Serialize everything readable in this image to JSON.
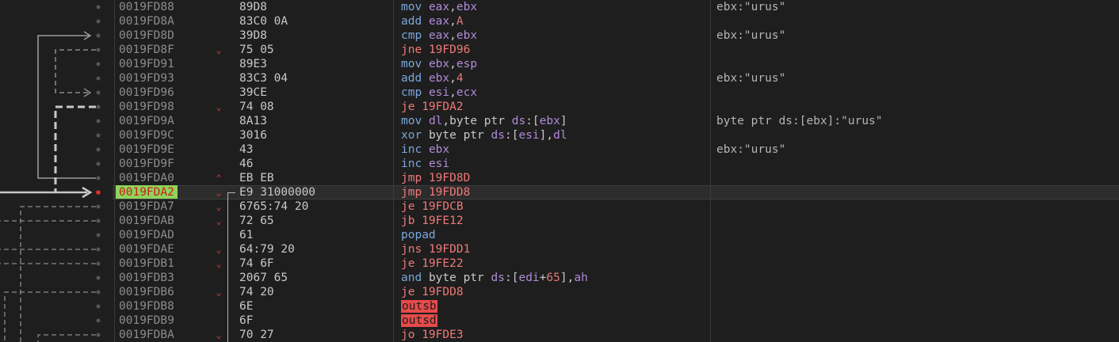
{
  "rows": [
    {
      "addr": "0019FD88",
      "mark": "",
      "bytes": "89D8",
      "mn": "mov",
      "ops": "eax,ebx",
      "kind": "m",
      "comment": "ebx:\"urus\""
    },
    {
      "addr": "0019FD8A",
      "mark": "",
      "bytes": "83C0 0A",
      "mn": "add",
      "ops": "eax,A",
      "kind": "m",
      "comment": ""
    },
    {
      "addr": "0019FD8D",
      "mark": "",
      "bytes": "39D8",
      "mn": "cmp",
      "ops": "eax,ebx",
      "kind": "m",
      "comment": "ebx:\"urus\""
    },
    {
      "addr": "0019FD8F",
      "mark": "⌄",
      "bytes": "75 05",
      "mn": "jne",
      "ops": "19FD96",
      "kind": "j",
      "comment": ""
    },
    {
      "addr": "0019FD91",
      "mark": "",
      "bytes": "89E3",
      "mn": "mov",
      "ops": "ebx,esp",
      "kind": "m",
      "comment": ""
    },
    {
      "addr": "0019FD93",
      "mark": "",
      "bytes": "83C3 04",
      "mn": "add",
      "ops": "ebx,4",
      "kind": "m",
      "comment": "ebx:\"urus\""
    },
    {
      "addr": "0019FD96",
      "mark": "",
      "bytes": "39CE",
      "mn": "cmp",
      "ops": "esi,ecx",
      "kind": "m",
      "comment": ""
    },
    {
      "addr": "0019FD98",
      "mark": "⌄",
      "bytes": "74 08",
      "mn": "je",
      "ops": "19FDA2",
      "kind": "j",
      "comment": ""
    },
    {
      "addr": "0019FD9A",
      "mark": "",
      "bytes": "8A13",
      "mn": "mov",
      "ops": "dl,byte ptr ds:[ebx]",
      "kind": "m",
      "comment": "byte ptr ds:[ebx]:\"urus\""
    },
    {
      "addr": "0019FD9C",
      "mark": "",
      "bytes": "3016",
      "mn": "xor",
      "ops": "byte ptr ds:[esi],dl",
      "kind": "m",
      "comment": ""
    },
    {
      "addr": "0019FD9E",
      "mark": "",
      "bytes": "43",
      "mn": "inc",
      "ops": "ebx",
      "kind": "m",
      "comment": "ebx:\"urus\""
    },
    {
      "addr": "0019FD9F",
      "mark": "",
      "bytes": "46",
      "mn": "inc",
      "ops": "esi",
      "kind": "m",
      "comment": ""
    },
    {
      "addr": "0019FDA0",
      "mark": "⌃",
      "bytes": "EB EB",
      "mn": "jmp",
      "ops": "19FD8D",
      "kind": "j",
      "comment": ""
    },
    {
      "addr": "0019FDA2",
      "mark": "⌄",
      "bytes": "E9 31000000",
      "mn": "jmp",
      "ops": "19FDD8",
      "kind": "j",
      "comment": "",
      "current": true
    },
    {
      "addr": "0019FDA7",
      "mark": "⌄",
      "bytes": "6765:74 20",
      "mn": "je",
      "ops": "19FDCB",
      "kind": "j",
      "comment": ""
    },
    {
      "addr": "0019FDAB",
      "mark": "⌄",
      "bytes": "72 65",
      "mn": "jb",
      "ops": "19FE12",
      "kind": "j",
      "comment": ""
    },
    {
      "addr": "0019FDAD",
      "mark": "",
      "bytes": "61",
      "mn": "popad",
      "ops": "",
      "kind": "m",
      "comment": ""
    },
    {
      "addr": "0019FDAE",
      "mark": "⌄",
      "bytes": "64:79 20",
      "mn": "jns",
      "ops": "19FDD1",
      "kind": "j",
      "comment": ""
    },
    {
      "addr": "0019FDB1",
      "mark": "⌄",
      "bytes": "74 6F",
      "mn": "je",
      "ops": "19FE22",
      "kind": "j",
      "comment": ""
    },
    {
      "addr": "0019FDB3",
      "mark": "",
      "bytes": "2067 65",
      "mn": "and",
      "ops": "byte ptr ds:[edi+65],ah",
      "kind": "m",
      "comment": ""
    },
    {
      "addr": "0019FDB6",
      "mark": "⌄",
      "bytes": "74 20",
      "mn": "je",
      "ops": "19FDD8",
      "kind": "j",
      "comment": ""
    },
    {
      "addr": "0019FDB8",
      "mark": "",
      "bytes": "6E",
      "mn": "outsb",
      "ops": "",
      "kind": "bad",
      "comment": ""
    },
    {
      "addr": "0019FDB9",
      "mark": "",
      "bytes": "6F",
      "mn": "outsd",
      "ops": "",
      "kind": "bad",
      "comment": ""
    },
    {
      "addr": "0019FDBA",
      "mark": "⌄",
      "bytes": "70 27",
      "mn": "jo",
      "ops": "19FDE3",
      "kind": "j",
      "comment": ""
    }
  ],
  "colors": {
    "background": "#1e1e1e",
    "address": "#8c8c8c",
    "current_address_bg": "#8fd45a",
    "current_address_fg": "#c81e1e",
    "jump": "#f07878",
    "instruction": "#7aa6da",
    "bad_bg": "#e84a4a",
    "register": "#b08ad8"
  },
  "icons": {
    "breakpoint_dot": "dot-icon",
    "jump_down": "chevron-down-icon",
    "jump_up": "chevron-up-icon",
    "current_ip": "arrow-right-icon"
  }
}
